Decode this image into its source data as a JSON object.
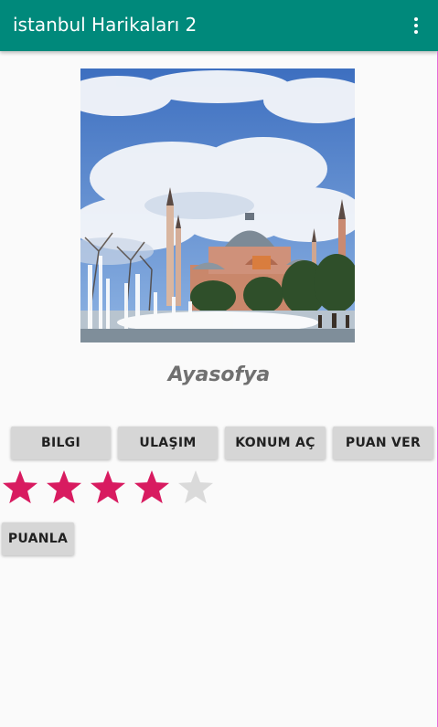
{
  "app_bar": {
    "title": "istanbul Harikaları 2",
    "background": "#00897b",
    "menu_icon": "more-vert-icon"
  },
  "place": {
    "name": "Ayasofya",
    "image_icon": "hagia-sophia-photo"
  },
  "buttons": {
    "info": "BILGI",
    "transport": "ULAŞIM",
    "open_location": "KONUM AÇ",
    "give_rating": "PUAN VER"
  },
  "rating": {
    "value": 4,
    "max": 5,
    "filled_color": "#d81b60",
    "empty_color": "#dadada"
  },
  "rate_button": "PUANLA"
}
